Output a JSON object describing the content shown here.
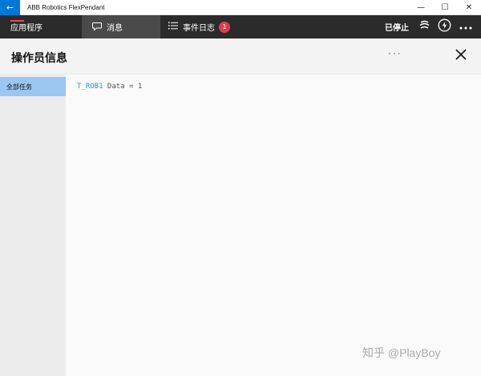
{
  "window": {
    "title": "ABB Robotics FlexPendant",
    "back_icon": "←",
    "minimize_icon": "—",
    "maximize_icon": "☐",
    "close_icon": "✕"
  },
  "appbar": {
    "home_label": "应用程序",
    "tabs": [
      {
        "label": "消息",
        "icon": "chat-bubble-icon"
      },
      {
        "label": "事件日志",
        "icon": "list-icon",
        "badge": "1"
      }
    ],
    "status": "已停止",
    "icons": [
      "motor-on-icon",
      "lightning-icon",
      "more-icon"
    ]
  },
  "panel": {
    "title": "操作员信息",
    "more": "···",
    "close_icon": "close-icon"
  },
  "sidebar": {
    "items": [
      {
        "label": "全部任务",
        "selected": true
      }
    ]
  },
  "content": {
    "task": "T_ROB1",
    "text": " Data = 1"
  },
  "watermark": "知乎 @PlayBoy",
  "colors": {
    "accent": "#0078d7",
    "appbar_bg": "#2b2b2b",
    "active_tab_bg": "#4a4a4a",
    "badge": "#e03b4a",
    "selected_item": "#9ac6f0",
    "task_name": "#1f9bd4"
  }
}
